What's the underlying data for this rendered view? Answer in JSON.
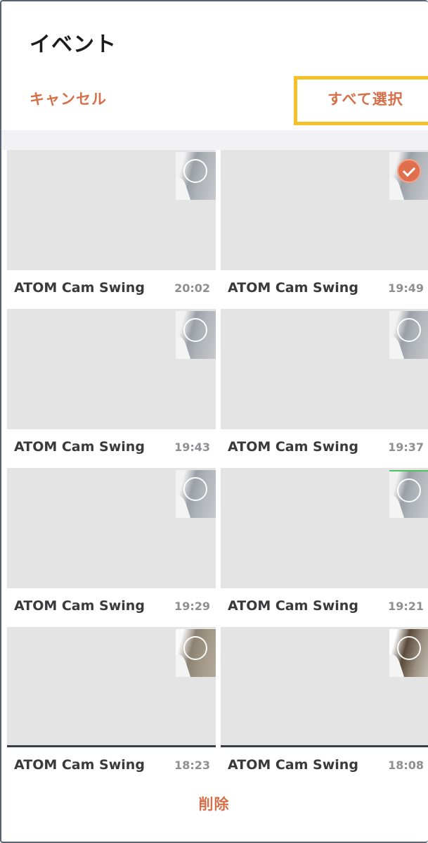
{
  "header": {
    "title": "イベント",
    "cancel_label": "キャンセル",
    "select_all_label": "すべて選択"
  },
  "events": [
    {
      "name": "ATOM Cam Swing",
      "time": "20:02",
      "selected": false,
      "thumb": "normal"
    },
    {
      "name": "ATOM Cam Swing",
      "time": "19:49",
      "selected": true,
      "thumb": "normal"
    },
    {
      "name": "ATOM Cam Swing",
      "time": "19:43",
      "selected": false,
      "thumb": "normal"
    },
    {
      "name": "ATOM Cam Swing",
      "time": "19:37",
      "selected": false,
      "thumb": "normal"
    },
    {
      "name": "ATOM Cam Swing",
      "time": "19:29",
      "selected": false,
      "thumb": "normal"
    },
    {
      "name": "ATOM Cam Swing",
      "time": "19:21",
      "selected": false,
      "thumb": "green"
    },
    {
      "name": "ATOM Cam Swing",
      "time": "18:23",
      "selected": false,
      "thumb": "warm"
    },
    {
      "name": "ATOM Cam Swing",
      "time": "18:08",
      "selected": false,
      "thumb": "dark"
    }
  ],
  "footer": {
    "delete_label": "削除"
  },
  "colors": {
    "accent": "#d5704a",
    "highlight_box": "#f5c12a",
    "checked_circle": "#e06f4d",
    "thumbnail_bg": "#e4e4e4"
  },
  "icons": {
    "select_circle": "selection-circle-icon",
    "checkmark": "checkmark-icon"
  }
}
